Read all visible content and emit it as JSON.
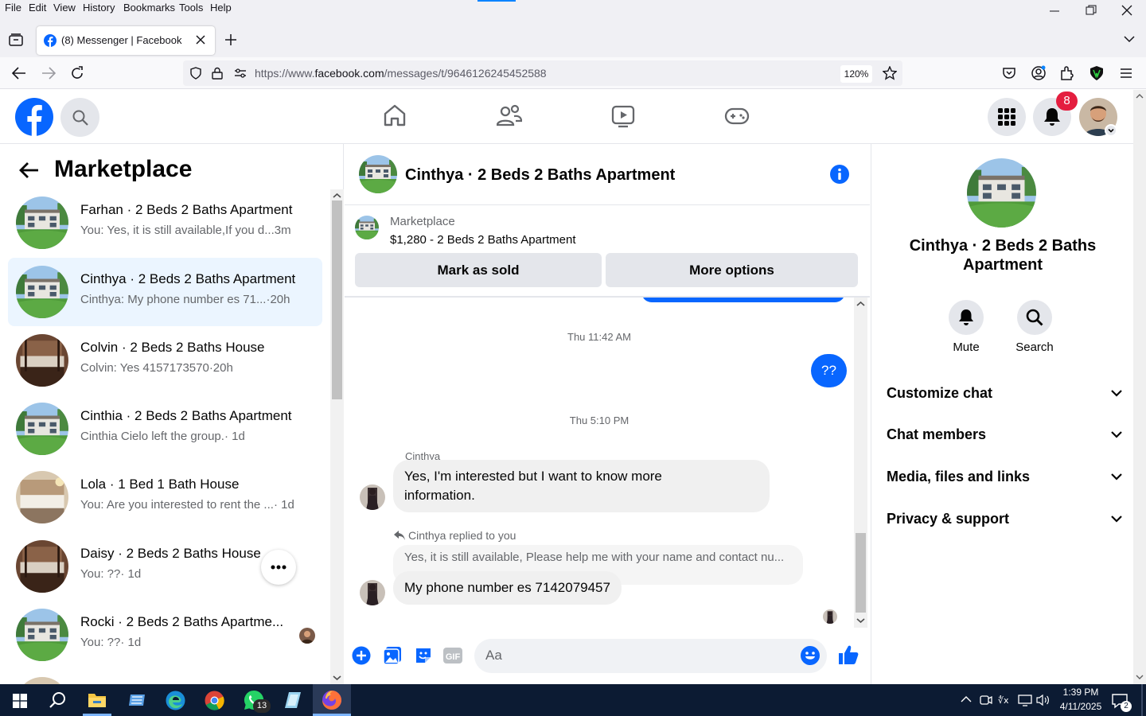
{
  "browser": {
    "menu": [
      "File",
      "Edit",
      "View",
      "History",
      "Bookmarks",
      "Tools",
      "Help"
    ],
    "tab_title": "(8) Messenger | Facebook",
    "url_prefix": "https://www.",
    "url_domain": "facebook.com",
    "url_path": "/messages/t/9646126245452588",
    "zoom": "120%"
  },
  "header": {
    "notification_count": "8",
    "brand_color": "#0866ff"
  },
  "left": {
    "title": "Marketplace",
    "conversations": [
      {
        "title": "Farhan · 2 Beds 2 Baths Apartment",
        "snippet": "You: Yes, it is still available,If you d...",
        "time": "3m",
        "thumb": "house"
      },
      {
        "title": "Cinthya · 2 Beds 2 Baths Apartment",
        "snippet": "Cinthya: My phone number es 71...",
        "time": "·20h",
        "thumb": "house"
      },
      {
        "title": "Colvin · 2 Beds 2 Baths House",
        "snippet": "Colvin: Yes 4157173570",
        "time": "·20h",
        "thumb": "bedroom"
      },
      {
        "title": "Cinthia · 2 Beds 2 Baths Apartment",
        "snippet": "Cinthia Cielo left the group.",
        "time": "· 1d",
        "thumb": "house"
      },
      {
        "title": "Lola · 1 Bed 1 Bath House",
        "snippet": "You: Are you interested to rent the ...",
        "time": "· 1d",
        "thumb": "bedroom-light"
      },
      {
        "title": "Daisy · 2 Beds 2 Baths House",
        "snippet": "You: ??",
        "time": "· 1d",
        "thumb": "bedroom"
      },
      {
        "title": "Rocki · 2 Beds 2 Baths Apartme...",
        "snippet": "You: ??",
        "time": "· 1d",
        "thumb": "house"
      }
    ]
  },
  "chat": {
    "title": "Cinthya · 2 Beds 2 Baths Apartment",
    "listing_label": "Marketplace",
    "listing_text": "$1,280 - 2 Beds 2 Baths Apartment",
    "mark_sold": "Mark as sold",
    "more_options": "More options",
    "ts1": "Thu 11:42 AM",
    "outgoing": "??",
    "ts2": "Thu 5:10 PM",
    "sender": "Cinthya",
    "msg1_line1": "Yes, I'm interested but I want to know more",
    "msg1_line2": "information.",
    "reply_label": "Cinthya replied to you",
    "quoted": "Yes, it is still available, Please help me with your name and contact nu...",
    "msg2": "My phone number es 7142079457",
    "composer_placeholder": "Aa"
  },
  "details": {
    "name_line1": "Cinthya · 2 Beds 2 Baths",
    "name_line2": "Apartment",
    "mute": "Mute",
    "search": "Search",
    "sections": [
      "Customize chat",
      "Chat members",
      "Media, files and links",
      "Privacy & support"
    ]
  },
  "taskbar": {
    "time": "1:39 PM",
    "date": "4/11/2025",
    "whatsapp_badge": "13",
    "notif_badge": "2"
  }
}
